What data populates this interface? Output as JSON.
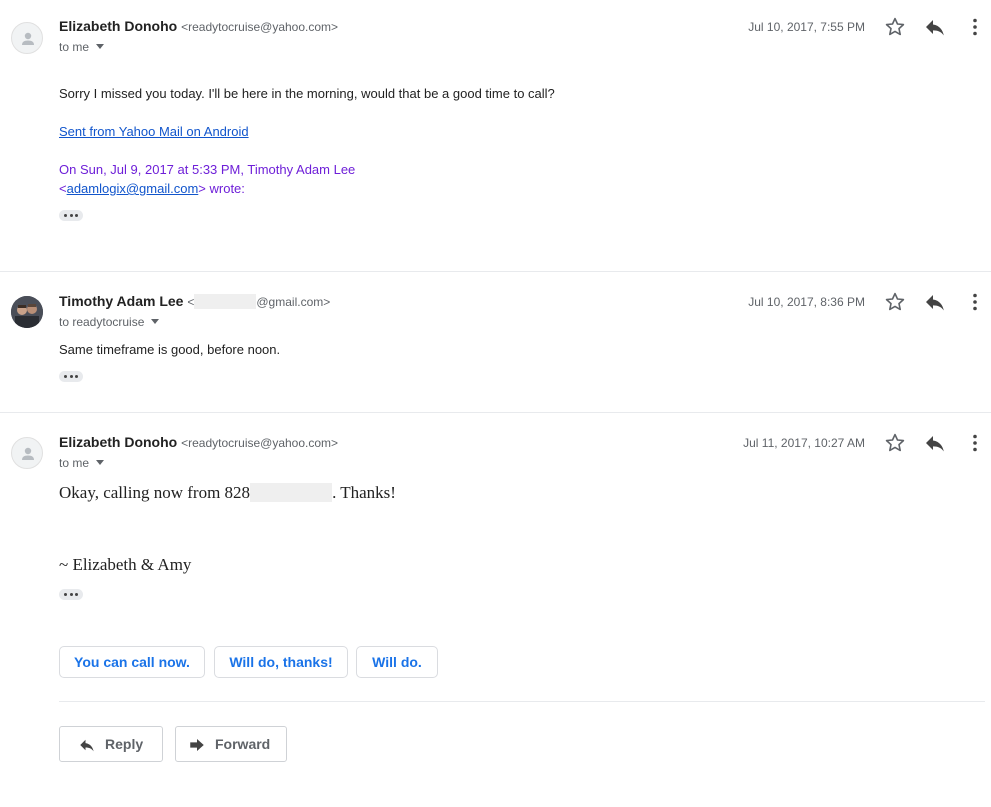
{
  "messages": [
    {
      "sender_name": "Elizabeth Donoho",
      "sender_email": "<readytocruise@yahoo.com>",
      "recipient": "to me",
      "timestamp": "Jul 10, 2017, 7:55 PM",
      "body": "Sorry I missed you today. I'll be here in the morning, would that be a good time to call?",
      "signature_link": "Sent from Yahoo Mail on Android",
      "quote_line1": "On Sun, Jul 9, 2017 at 5:33 PM, Timothy Adam Lee",
      "quote_open": "<",
      "quote_email": "adamlogix@gmail.com",
      "quote_close": "> wrote:"
    },
    {
      "sender_name": "Timothy Adam Lee",
      "sender_email_prefix": "<",
      "sender_email_suffix": "@gmail.com>",
      "recipient": "to readytocruise",
      "timestamp": "Jul 10, 2017, 8:36 PM",
      "body": "Same timeframe is good, before noon."
    },
    {
      "sender_name": "Elizabeth Donoho",
      "sender_email": "<readytocruise@yahoo.com>",
      "recipient": "to me",
      "timestamp": "Jul 11, 2017, 10:27 AM",
      "body_prefix": "Okay, calling now from 828",
      "body_suffix": ". Thanks!",
      "signature": "~ Elizabeth & Amy"
    }
  ],
  "smart_replies": [
    "You can call now.",
    "Will do, thanks!",
    "Will do."
  ],
  "actions": {
    "reply": "Reply",
    "forward": "Forward"
  },
  "icons": {
    "star": "star-outline-icon",
    "reply": "reply-arrow-icon",
    "more": "vertical-dots-icon",
    "forward": "forward-arrow-icon",
    "avatar": "person-silhouette-icon"
  },
  "colors": {
    "link": "#1155cc",
    "quote": "#6e1fd8",
    "smart_reply": "#1a73e8",
    "muted": "#5f6368"
  }
}
